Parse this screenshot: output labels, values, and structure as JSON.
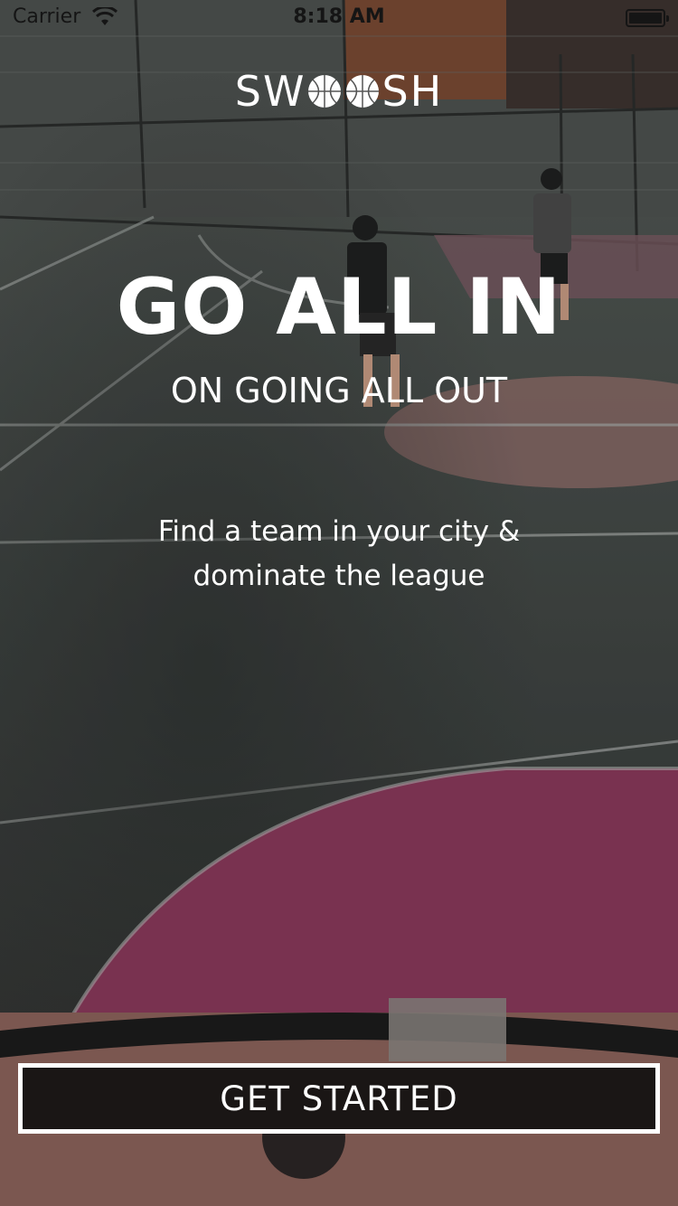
{
  "status_bar": {
    "carrier": "Carrier",
    "time": "8:18 AM"
  },
  "logo": {
    "text_left": "SW",
    "text_right": "SH",
    "icon": "basketball-icon"
  },
  "hero": {
    "headline": "GO ALL IN",
    "subheadline": "ON GOING ALL OUT",
    "tagline_line1": "Find a team in your city &",
    "tagline_line2": "dominate the league"
  },
  "cta": {
    "label": "GET STARTED"
  },
  "colors": {
    "court_dark": "#3b3f3d",
    "court_pink": "#8a3a5c",
    "court_salmon": "#9e7670",
    "button_fill": "#1a1615",
    "text": "#ffffff"
  }
}
